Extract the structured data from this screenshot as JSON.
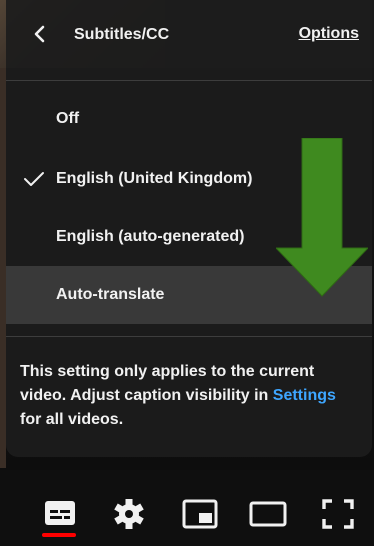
{
  "header": {
    "title": "Subtitles/CC",
    "options_label": "Options"
  },
  "menu": {
    "items": [
      {
        "label": "Off",
        "selected": false
      },
      {
        "label": "English (United Kingdom)",
        "selected": true
      },
      {
        "label": "English (auto-generated)",
        "selected": false
      },
      {
        "label": "Auto-translate",
        "selected": false,
        "highlighted": true
      }
    ]
  },
  "notice": {
    "text_before": "This setting only applies to the current video. Adjust caption visibility in ",
    "link_text": "Settings",
    "text_after": " for all videos."
  },
  "controls": {
    "icons": [
      "subtitles-icon",
      "settings-gear-icon",
      "miniplayer-icon",
      "theater-mode-icon",
      "fullscreen-icon"
    ],
    "active_color": "#ff0000"
  },
  "colors": {
    "link": "#3ea6ff",
    "arrow": "#3f8a1f",
    "panel": "#1c1c1c",
    "highlight": "#393939"
  }
}
